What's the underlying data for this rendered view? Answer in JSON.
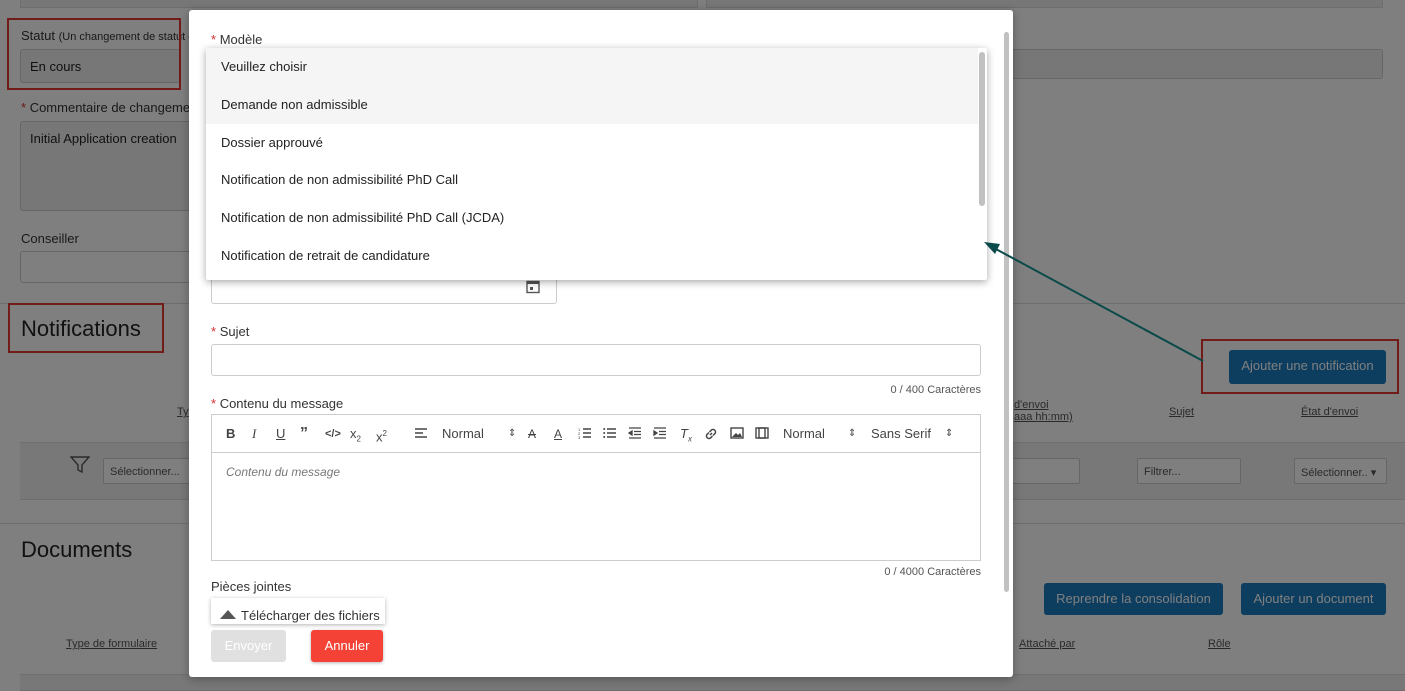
{
  "background": {
    "status_label": "Statut",
    "status_note": "(Un changement de statut o",
    "status_value": "En cours",
    "comment_label": "Commentaire de changemen",
    "comment_value": "Initial Application creation",
    "advisor_label": "Conseiller",
    "notifications_title": "Notifications",
    "add_notification_label": "Ajouter une notification",
    "notif_columns": {
      "type": "Ty",
      "send_date_1": "d'envoi",
      "send_date_2": "aaa hh:mm)",
      "subject": "Sujet",
      "send_state": "État d'envoi"
    },
    "filter_select_placeholder": "Sélectionner...",
    "filter_text_placeholder": "Filtrer...",
    "filter_select2_placeholder": "Sélectionner..",
    "documents_title": "Documents",
    "resume_consolidation_label": "Reprendre la consolidation",
    "add_document_label": "Ajouter un document",
    "doc_columns": {
      "form_type": "Type de formulaire",
      "attached_by": "Attaché par",
      "role": "Rôle"
    }
  },
  "modal": {
    "template_label": "Modèle",
    "subject_label": "Sujet",
    "subject_counter": "0 / 400 Caractères",
    "content_label": "Contenu du message",
    "content_placeholder": "Contenu du message",
    "content_counter": "0 / 4000 Caractères",
    "heading_select": "Normal",
    "size_select": "Normal",
    "font_select": "Sans Serif",
    "attachments_label": "Pièces jointes",
    "upload_label": "Télécharger des fichiers",
    "send_label": "Envoyer",
    "cancel_label": "Annuler"
  },
  "dropdown": {
    "options": [
      "Veuillez choisir",
      "Demande non admissible",
      "Dossier approuvé",
      "Notification de non admissibilité PhD Call",
      "Notification de non admissibilité PhD Call (JCDA)",
      "Notification de retrait de candidature"
    ]
  },
  "colors": {
    "primary_button": "#1a7bbf",
    "cancel_button": "#f44336",
    "highlight_box": "#e53935",
    "arrow": "#0b4a4a"
  }
}
